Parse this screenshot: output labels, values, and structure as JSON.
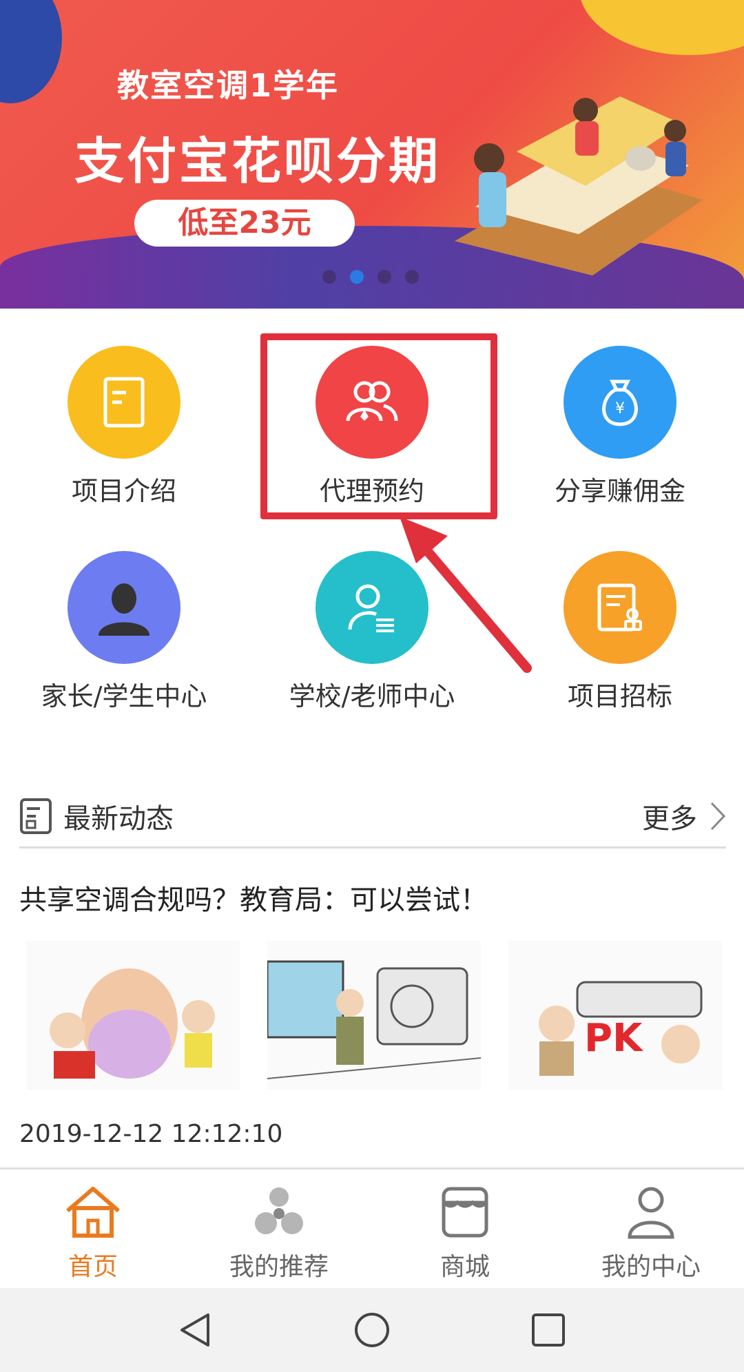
{
  "banner": {
    "line1": "教室空调1学年",
    "line2": "支付宝花呗分期",
    "price_pill": "低至23元",
    "dots": 4,
    "active_dot": 1
  },
  "grid": {
    "items": [
      {
        "label": "项目介绍",
        "icon": "document-icon",
        "color": "#f9bd1e"
      },
      {
        "label": "代理预约",
        "icon": "people-icon",
        "color": "#f04447"
      },
      {
        "label": "分享赚佣金",
        "icon": "money-bag-icon",
        "color": "#2f9df3"
      },
      {
        "label": "家长/学生中心",
        "icon": "person-silhouette-icon",
        "color": "#6d7cf0"
      },
      {
        "label": "学校/老师中心",
        "icon": "teacher-icon",
        "color": "#25bfcc"
      },
      {
        "label": "项目招标",
        "icon": "bid-document-icon",
        "color": "#f7a128"
      }
    ]
  },
  "news": {
    "section_title": "最新动态",
    "more_label": "更多",
    "headline": "共享空调合规吗？教育局：可以尝试！",
    "timestamp": "2019-12-12 12:12:10"
  },
  "tabbar": {
    "items": [
      {
        "label": "首页",
        "icon": "home-icon",
        "active": true
      },
      {
        "label": "我的推荐",
        "icon": "recommend-icon",
        "active": false
      },
      {
        "label": "商城",
        "icon": "store-icon",
        "active": false
      },
      {
        "label": "我的中心",
        "icon": "user-icon",
        "active": false
      }
    ]
  },
  "colors": {
    "accent": "#ea7a1e",
    "highlight_annotation": "#e0303c"
  }
}
